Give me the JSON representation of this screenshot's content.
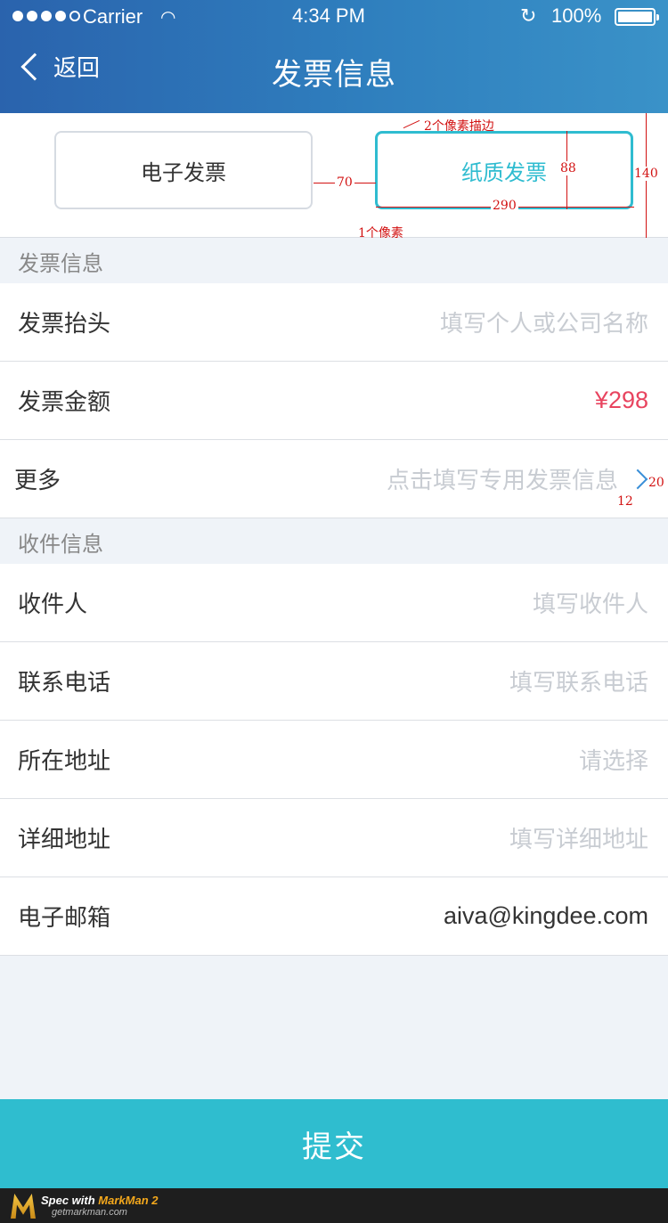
{
  "status_bar": {
    "carrier": "Carrier",
    "time": "4:34 PM",
    "battery": "100%"
  },
  "nav": {
    "back_label": "返回",
    "title": "发票信息"
  },
  "invoice_type": {
    "options": [
      "电子发票",
      "纸质发票"
    ],
    "selected": "纸质发票"
  },
  "spec_notes": {
    "stroke_2px": "2个像素描边",
    "line_1px": "1个像素",
    "gap": "70",
    "btn_width": "290",
    "btn_height": "88",
    "area_height": "140",
    "arrow_size": "12",
    "arrow_margin": "20"
  },
  "sections": {
    "invoice": "发票信息",
    "shipping": "收件信息"
  },
  "invoice_rows": [
    {
      "label": "发票抬头",
      "placeholder": "填写个人或公司名称"
    },
    {
      "label": "发票金额",
      "value": "¥298"
    },
    {
      "label": "更多",
      "placeholder": "点击填写专用发票信息"
    }
  ],
  "shipping_rows": [
    {
      "label": "收件人",
      "placeholder": "填写收件人"
    },
    {
      "label": "联系电话",
      "placeholder": "填写联系电话"
    },
    {
      "label": "所在地址",
      "placeholder": "请选择"
    },
    {
      "label": "详细地址",
      "placeholder": "填写详细地址"
    },
    {
      "label": "电子邮箱",
      "value": "aiva@kingdee.com"
    }
  ],
  "submit_label": "提交",
  "footer": {
    "line1_prefix": "Spec with ",
    "brand": "MarkMan 2",
    "line2": "getmarkman.com"
  },
  "colors": {
    "accent": "#2fbdcf",
    "header": "#2f7fbe",
    "price": "#e8445f"
  }
}
